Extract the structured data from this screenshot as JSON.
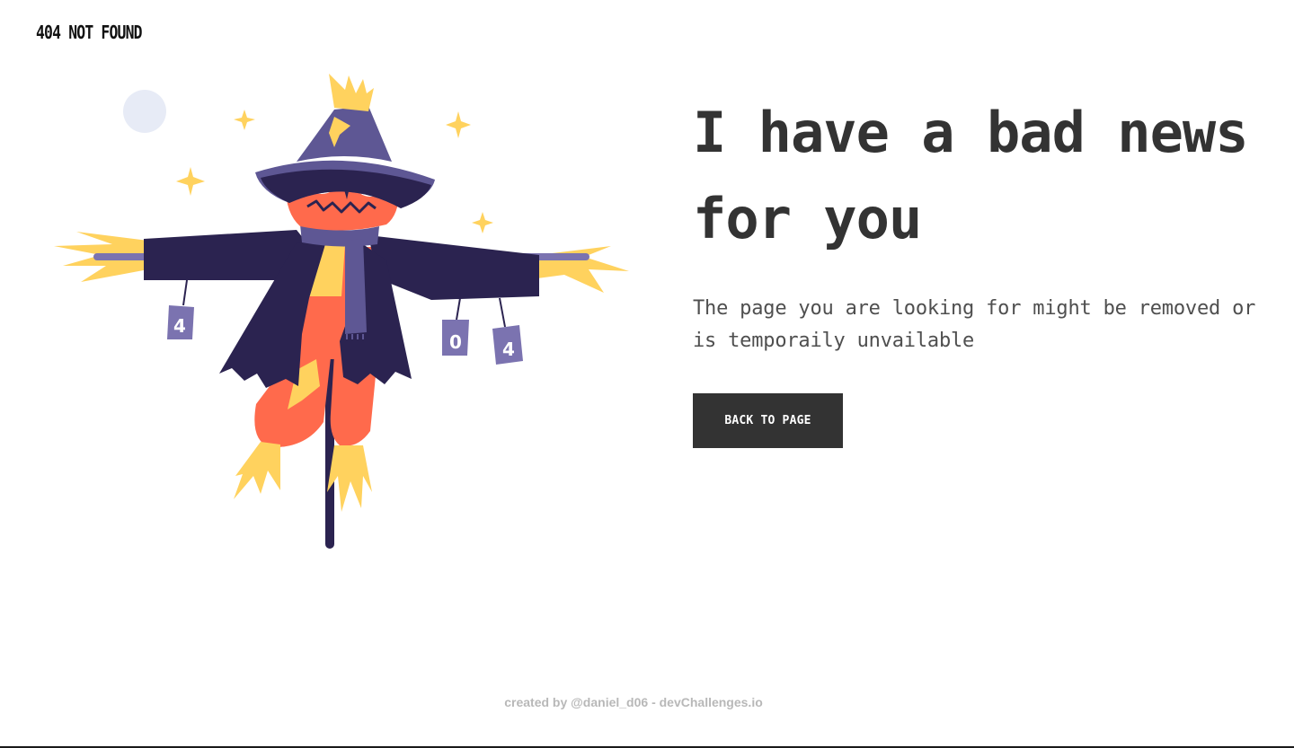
{
  "brand": "404 NOT FOUND",
  "headline": "I have a bad news for you",
  "subtext": "The page you are looking for might be removed or is temporaily unvailable",
  "back_button_label": "BACK TO PAGE",
  "footer": "created by @daniel_d06 - devChallenges.io",
  "cans": [
    "4",
    "0",
    "4"
  ],
  "colors": {
    "text": "#333333",
    "button": "#333333",
    "hat": "#5E5794",
    "coat": "#2B2350",
    "pumpkin": "#FF6A4C",
    "straw": "#FFD25E",
    "moon": "#E7EBF6"
  },
  "illustration_alt": "scarecrow-illustration"
}
